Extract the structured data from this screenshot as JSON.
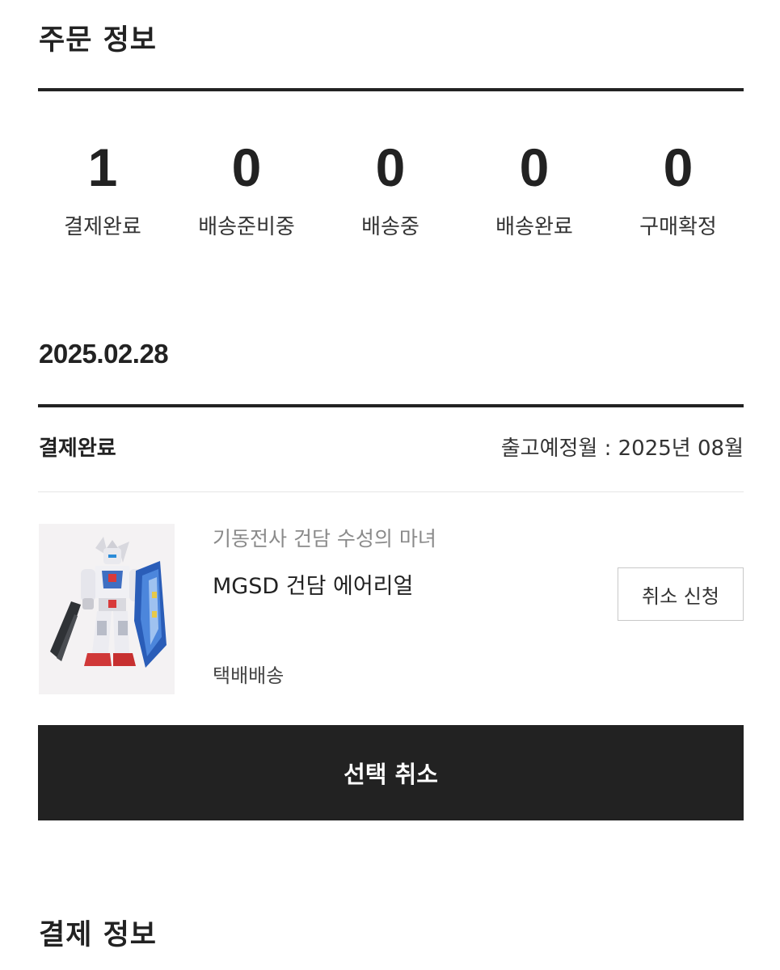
{
  "order_info": {
    "title": "주문 정보",
    "statuses": [
      {
        "count": "1",
        "label": "결제완료"
      },
      {
        "count": "0",
        "label": "배송준비중"
      },
      {
        "count": "0",
        "label": "배송중"
      },
      {
        "count": "0",
        "label": "배송완료"
      },
      {
        "count": "0",
        "label": "구매확정"
      }
    ]
  },
  "order": {
    "date": "2025.02.28",
    "status": "결제완료",
    "release_info": "출고예정월 : 2025년 08월",
    "product": {
      "series": "기동전사 건담 수성의 마녀",
      "name": "MGSD 건담 에어리얼",
      "delivery": "택배배송",
      "image_icon": "gundam-model-image",
      "cancel_request_label": "취소 신청"
    },
    "select_cancel_label": "선택 취소"
  },
  "payment_info": {
    "title": "결제 정보"
  },
  "colors": {
    "text_primary": "#222222",
    "text_muted": "#8a8a8a",
    "button_dark": "#222222",
    "divider": "#e5e5e5"
  }
}
